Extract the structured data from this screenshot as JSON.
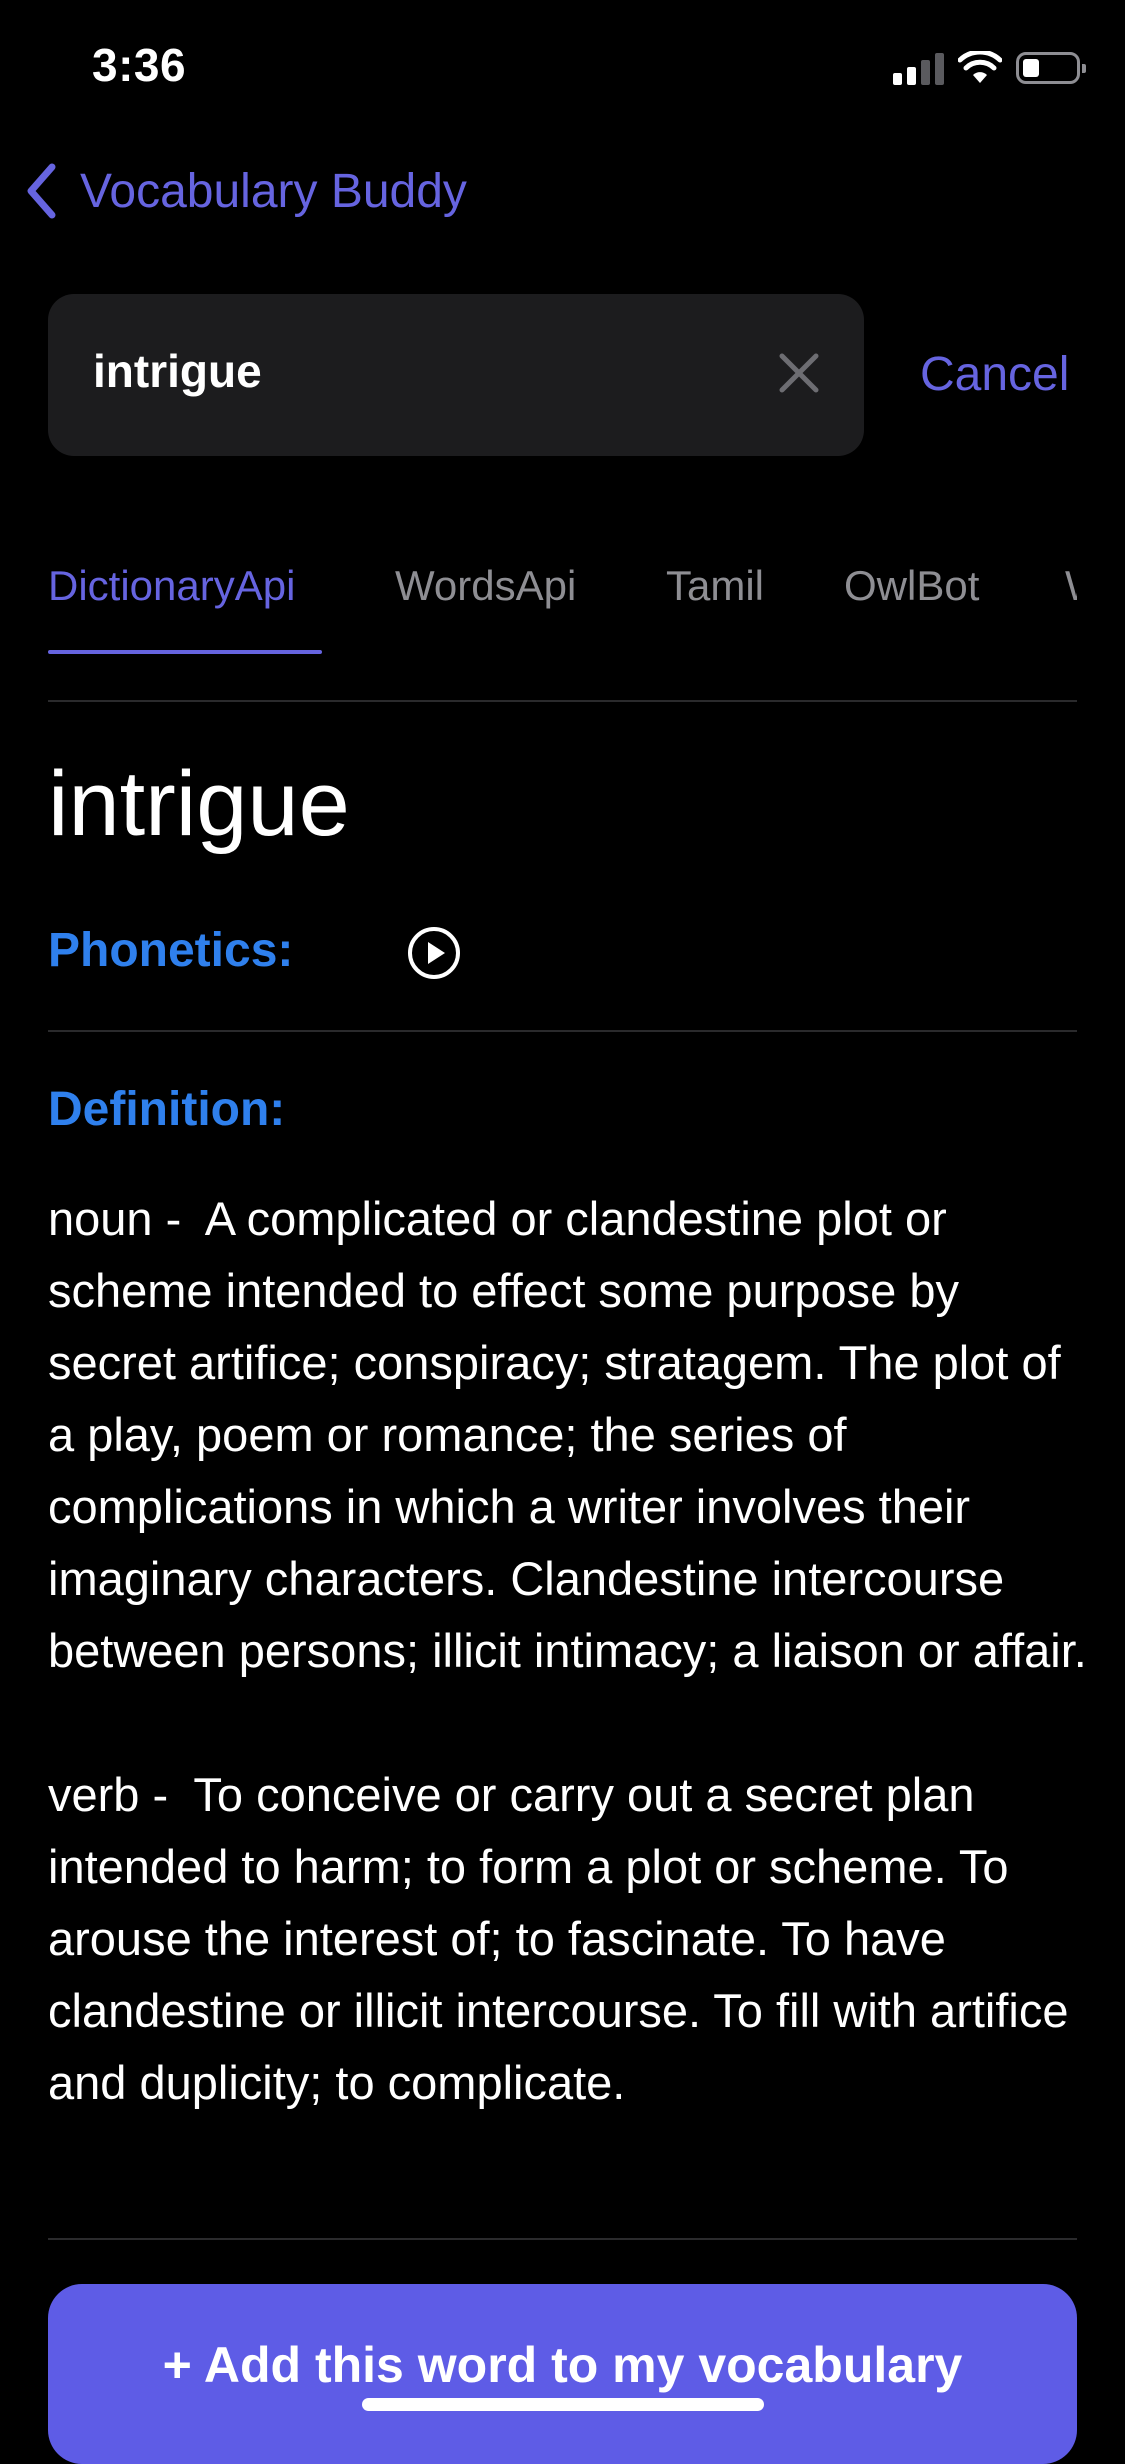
{
  "status_bar": {
    "time": "3:36",
    "signal_bars_active": 2,
    "battery_level": 0.3
  },
  "nav": {
    "back_label": "Vocabulary Buddy"
  },
  "search": {
    "value": "intrigue",
    "cancel_label": "Cancel"
  },
  "tabs": [
    {
      "label": "DictionaryApi",
      "active": true
    },
    {
      "label": "WordsApi",
      "active": false
    },
    {
      "label": "Tamil",
      "active": false
    },
    {
      "label": "OwlBot",
      "active": false
    },
    {
      "label": "W",
      "active": false
    }
  ],
  "entry": {
    "word": "intrigue",
    "phonetics_label": "Phonetics:",
    "definition_label": "Definition:",
    "definition_text": "noun -  A complicated or clandestine plot or scheme intended to effect some purpose by secret artifice; conspiracy; stratagem. The plot of a play, poem or romance; the series of complications in which a writer involves their imaginary characters. Clandestine intercourse between persons; illicit intimacy; a liaison or affair.\n\nverb -  To conceive or carry out a secret plan intended to harm; to form a plot or scheme. To arouse the interest of; to fascinate. To have clandestine or illicit intercourse. To fill with artifice and duplicity; to complicate."
  },
  "actions": {
    "add_label": "+ Add this word to my vocabulary"
  },
  "colors": {
    "accent": "#6664e0",
    "label_blue": "#2f80ed",
    "button": "#5e5ce6",
    "background": "#000000"
  },
  "icons": [
    "signal-icon",
    "wifi-icon",
    "battery-icon",
    "chevron-left-icon",
    "clear-icon",
    "play-icon"
  ]
}
